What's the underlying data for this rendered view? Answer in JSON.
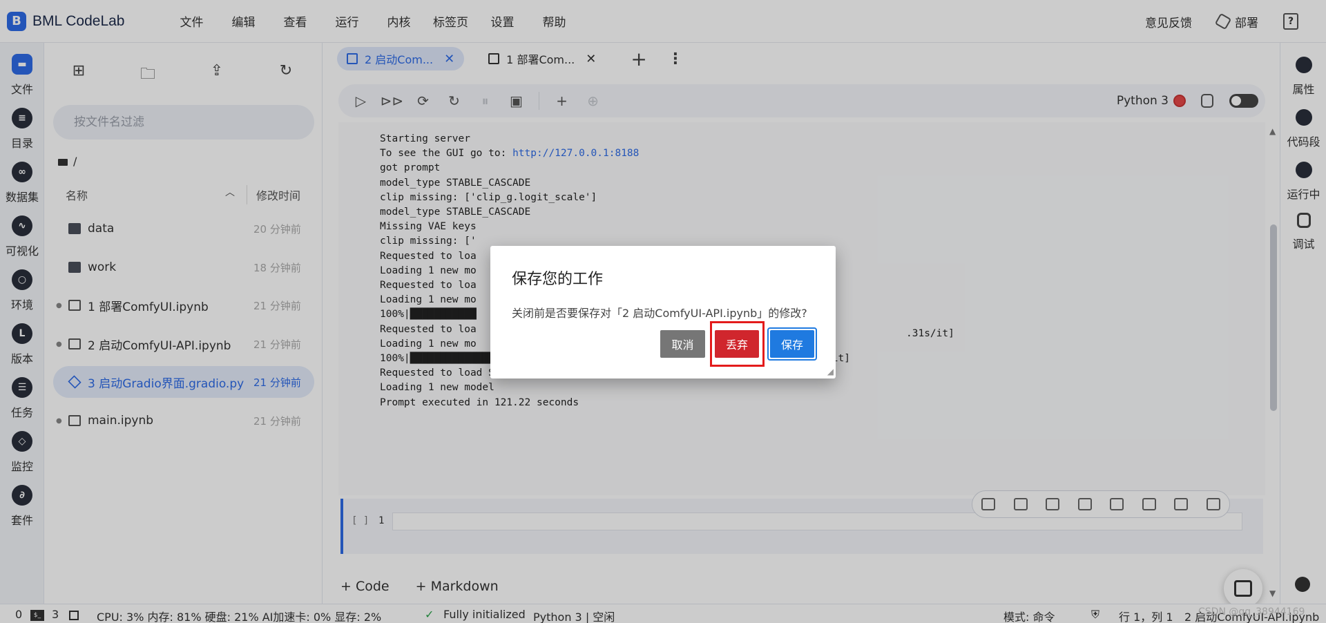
{
  "app": {
    "logo_text": "BML CodeLab"
  },
  "menu": [
    "文件",
    "编辑",
    "查看",
    "运行",
    "内核",
    "标签页",
    "设置",
    "帮助"
  ],
  "top_right": {
    "feedback": "意见反馈",
    "deploy": "部署",
    "help": "?"
  },
  "activity_bar": [
    {
      "label": "文件",
      "icon": "folder-icon"
    },
    {
      "label": "目录",
      "icon": "toc-icon"
    },
    {
      "label": "数据集",
      "icon": "dataset-icon"
    },
    {
      "label": "可视化",
      "icon": "chart-icon"
    },
    {
      "label": "环境",
      "icon": "environment-icon"
    },
    {
      "label": "版本",
      "icon": "clock-icon"
    },
    {
      "label": "任务",
      "icon": "task-icon"
    },
    {
      "label": "监控",
      "icon": "monitor-icon"
    },
    {
      "label": "套件",
      "icon": "suite-icon"
    }
  ],
  "file_panel": {
    "search_placeholder": "按文件名过滤",
    "breadcrumb": "/",
    "col_name": "名称",
    "col_time": "修改时间",
    "files": [
      {
        "name": "data",
        "time": "20 分钟前",
        "type": "folder"
      },
      {
        "name": "work",
        "time": "18 分钟前",
        "type": "folder"
      },
      {
        "name": "1 部署ComfyUI.ipynb",
        "time": "21 分钟前",
        "type": "notebook"
      },
      {
        "name": "2 启动ComfyUI-API.ipynb",
        "time": "21 分钟前",
        "type": "notebook"
      },
      {
        "name": "3 启动Gradio界面.gradio.py",
        "time": "21 分钟前",
        "type": "gradio",
        "selected": true
      },
      {
        "name": "main.ipynb",
        "time": "21 分钟前",
        "type": "notebook"
      }
    ]
  },
  "tabs": [
    {
      "label": "2 启动Com...",
      "close": "✕",
      "active": true
    },
    {
      "label": "1 部署Com...",
      "close": "✕",
      "active": false
    }
  ],
  "toolbar": {
    "kernel": "Python 3"
  },
  "output_lines": [
    "Starting server",
    "",
    "To see the GUI go to: ",
    "got prompt",
    "model_type STABLE_CASCADE",
    "clip missing: ['clip_g.logit_scale']",
    "model_type STABLE_CASCADE",
    "Missing VAE keys",
    "clip missing: ['",
    "Requested to loa",
    "Loading 1 new mo",
    "Requested to loa",
    "Loading 1 new mo",
    "100%|███████████",
    "Requested to loa",
    "Loading 1 new mo",
    "100%|█████████████████████████████████████████| 10/10 [00:10<00:00,  1.01s/it]",
    "Requested to load StageA",
    "Loading 1 new model",
    "Prompt executed in 121.22 seconds"
  ],
  "output_link": "http://127.0.0.1:8188",
  "output_tail_partial": ".31s/it]",
  "cell": {
    "prompt": "[ ]",
    "line_number": "1"
  },
  "add_cells": {
    "code": "+ Code",
    "markdown": "+ Markdown"
  },
  "right_bar": [
    {
      "label": "属性",
      "icon": "settings-icon"
    },
    {
      "label": "代码段",
      "icon": "snippet-icon"
    },
    {
      "label": "运行中",
      "icon": "running-icon"
    },
    {
      "label": "调试",
      "icon": "debug-icon"
    }
  ],
  "status": {
    "count_a": "0",
    "count_b": "3",
    "resources": "CPU:  3% 内存:  81% 硬盘:  21% AI加速卡:  0% 显存:  2%",
    "init": "Fully initialized",
    "kernel_state": "Python 3 | 空闲",
    "mode": "模式: 命令",
    "position": "行 1，列 1",
    "file": "2 启动ComfyUI-API.ipynb"
  },
  "watermark": "CSDN @qq_38944169",
  "modal": {
    "title": "保存您的工作",
    "body": "关闭前是否要保存对「2 启动ComfyUI-API.ipynb」的修改?",
    "cancel": "取消",
    "discard": "丢弃",
    "save": "保存"
  },
  "colors": {
    "accent": "#2e6be6",
    "discard": "#d0262d",
    "save": "#1f7ae0",
    "cancel": "#767676"
  }
}
